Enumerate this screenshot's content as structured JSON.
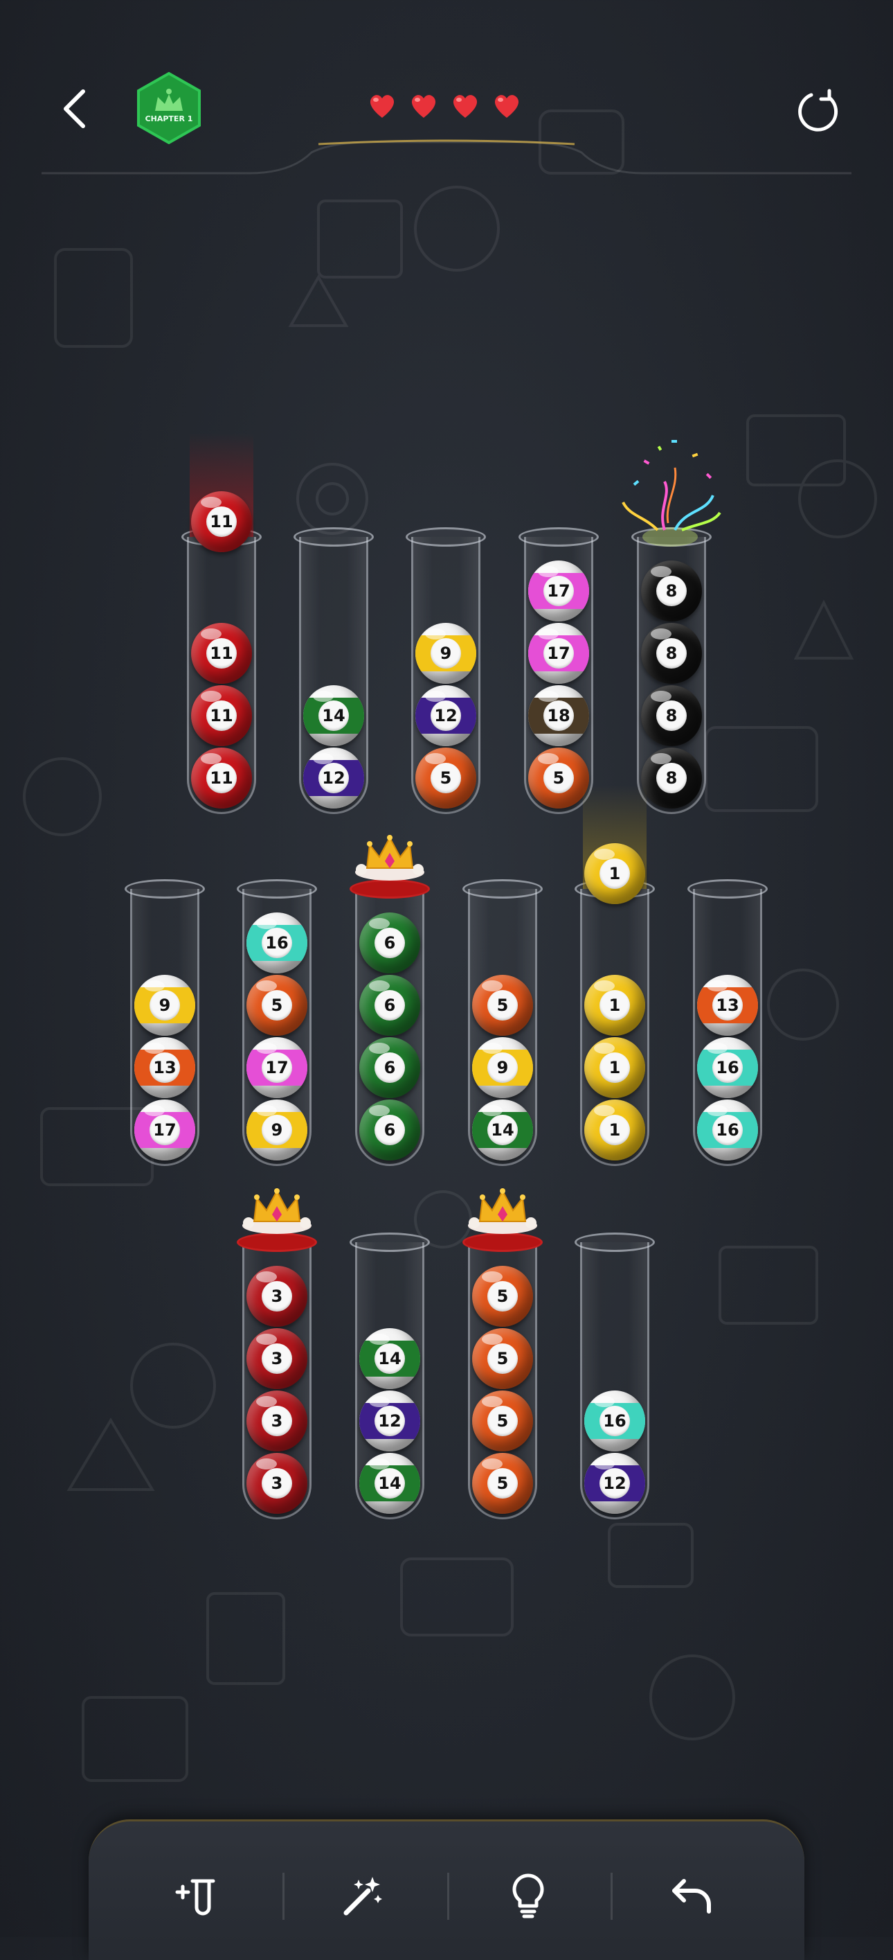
{
  "header": {
    "chapter_label": "CHAPTER 1",
    "lives": 4
  },
  "colors": {
    "red": "#c8151b",
    "green": "#1f7a2c",
    "purple": "#3d1f8a",
    "orange": "#e2551a",
    "yellow": "#f2c418",
    "magenta": "#e54fd6",
    "brown": "#4a3a26",
    "black": "#121212",
    "teal": "#3fd3bd",
    "darkred": "#b3161c"
  },
  "balls": {
    "b11": {
      "label": "11",
      "color": "red",
      "striped": false
    },
    "b14": {
      "label": "14",
      "color": "green",
      "striped": true
    },
    "b12": {
      "label": "12",
      "color": "purple",
      "striped": true
    },
    "b9": {
      "label": "9",
      "color": "yellow",
      "striped": true
    },
    "b5": {
      "label": "5",
      "color": "orange",
      "striped": false
    },
    "b17": {
      "label": "17",
      "color": "magenta",
      "striped": true
    },
    "b18": {
      "label": "18",
      "color": "brown",
      "striped": true
    },
    "b8": {
      "label": "8",
      "color": "black",
      "striped": false
    },
    "b16": {
      "label": "16",
      "color": "teal",
      "striped": true
    },
    "b13": {
      "label": "13",
      "color": "orange",
      "striped": true
    },
    "b6": {
      "label": "6",
      "color": "green",
      "striped": false
    },
    "b1": {
      "label": "1",
      "color": "yellow",
      "striped": false
    },
    "b3": {
      "label": "3",
      "color": "darkred",
      "striped": false
    }
  },
  "tubes": [
    {
      "balls": [
        "b11",
        "b11",
        "b11"
      ],
      "lifted": "b11",
      "state": "selected"
    },
    {
      "balls": [
        "b14",
        "b12"
      ],
      "state": "normal"
    },
    {
      "balls": [
        "b9",
        "b12",
        "b5"
      ],
      "state": "normal"
    },
    {
      "balls": [
        "b17",
        "b17",
        "b18",
        "b5"
      ],
      "state": "normal"
    },
    {
      "balls": [
        "b8",
        "b8",
        "b8",
        "b8"
      ],
      "state": "completed"
    },
    {
      "balls": [
        "b9",
        "b13",
        "b17"
      ],
      "state": "normal"
    },
    {
      "balls": [
        "b16",
        "b5",
        "b17",
        "b9"
      ],
      "state": "normal"
    },
    {
      "balls": [
        "b6",
        "b6",
        "b6",
        "b6"
      ],
      "state": "locked-completed"
    },
    {
      "balls": [
        "b5",
        "b9",
        "b14"
      ],
      "state": "normal"
    },
    {
      "balls": [
        "b1",
        "b1",
        "b1"
      ],
      "lifted": "b1",
      "state": "hint"
    },
    {
      "balls": [
        "b13",
        "b16",
        "b16"
      ],
      "state": "normal"
    },
    {
      "balls": [
        "b3",
        "b3",
        "b3",
        "b3"
      ],
      "state": "locked-completed"
    },
    {
      "balls": [
        "b14",
        "b12",
        "b14"
      ],
      "state": "normal"
    },
    {
      "balls": [
        "b5",
        "b5",
        "b5",
        "b5"
      ],
      "state": "locked-completed"
    },
    {
      "balls": [
        "b16",
        "b12"
      ],
      "state": "normal"
    }
  ],
  "toolbar": {
    "items": [
      {
        "name": "add-tube-icon"
      },
      {
        "name": "magic-wand-icon"
      },
      {
        "name": "hint-bulb-icon"
      },
      {
        "name": "undo-icon"
      }
    ]
  }
}
